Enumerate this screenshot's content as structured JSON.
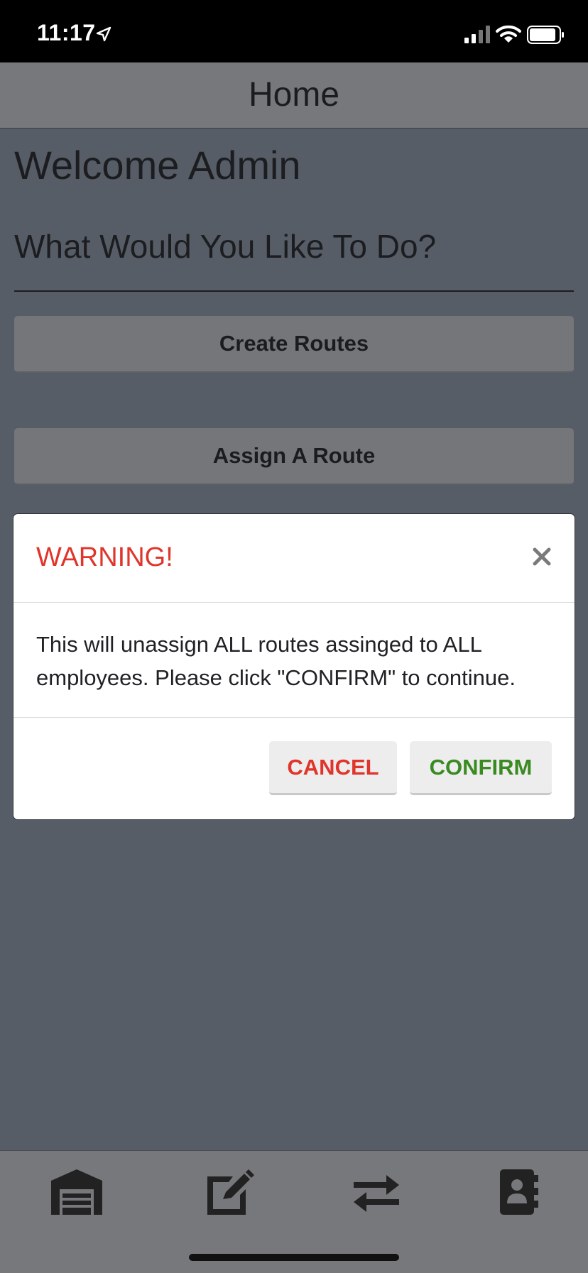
{
  "status_bar": {
    "time": "11:17"
  },
  "header": {
    "title": "Home"
  },
  "main": {
    "welcome": "Welcome Admin",
    "question": "What Would You Like To Do?",
    "buttons": [
      "Create Routes",
      "Assign A Route"
    ]
  },
  "modal": {
    "title": "WARNING!",
    "body": "This will unassign ALL routes assinged to ALL employees. Please click \"CONFIRM\" to continue.",
    "cancel_label": "CANCEL",
    "confirm_label": "CONFIRM"
  },
  "tabbar": {
    "icons": [
      "garage-icon",
      "edit-icon",
      "exchange-icon",
      "contacts-icon"
    ]
  },
  "colors": {
    "warning": "#e0352b",
    "confirm": "#3a8a22",
    "overlay_bg": "#575d66"
  }
}
